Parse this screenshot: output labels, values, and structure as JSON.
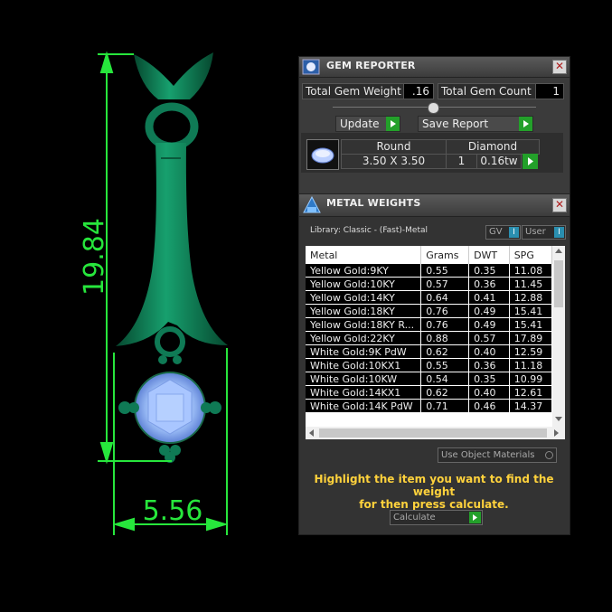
{
  "viewport": {
    "dim_height": "19.84",
    "dim_width": "5.56"
  },
  "gem_reporter": {
    "title": "GEM REPORTER",
    "close_symbol": "✕",
    "total_weight_label": "Total Gem Weight",
    "total_weight_value": ".16",
    "total_count_label": "Total Gem Count",
    "total_count_value": "1",
    "update_label": "Update",
    "save_report_label": "Save Report",
    "gem": {
      "shape": "Round",
      "type": "Diamond",
      "size": "3.50 X 3.50",
      "count": "1",
      "weight": "0.16tw"
    }
  },
  "metal_weights": {
    "title": "METAL WEIGHTS",
    "close_symbol": "✕",
    "library": "Library: Classic - (Fast)-Metal",
    "gv_label": "GV",
    "user_label": "User",
    "toggle_mark": "I",
    "columns": [
      "Metal",
      "Grams",
      "DWT",
      "SPG"
    ],
    "rows": [
      [
        "Yellow Gold:9KY",
        "0.55",
        "0.35",
        "11.08"
      ],
      [
        "Yellow Gold:10KY",
        "0.57",
        "0.36",
        "11.45"
      ],
      [
        "Yellow Gold:14KY",
        "0.64",
        "0.41",
        "12.88"
      ],
      [
        "Yellow Gold:18KY",
        "0.76",
        "0.49",
        "15.41"
      ],
      [
        "Yellow Gold:18KY R...",
        "0.76",
        "0.49",
        "15.41"
      ],
      [
        "Yellow Gold:22KY",
        "0.88",
        "0.57",
        "17.89"
      ],
      [
        "White Gold:9K PdW",
        "0.62",
        "0.40",
        "12.59"
      ],
      [
        "White Gold:10KX1",
        "0.55",
        "0.36",
        "11.18"
      ],
      [
        "White Gold:10KW",
        "0.54",
        "0.35",
        "10.99"
      ],
      [
        "White Gold:14KX1",
        "0.62",
        "0.40",
        "12.61"
      ],
      [
        "White Gold:14K PdW",
        "0.71",
        "0.46",
        "14.37"
      ]
    ],
    "use_object_materials": "Use Object Materials",
    "highlight_line1": "Highlight the item you want to find the weight",
    "highlight_line2": "for then press calculate.",
    "calculate_label": "Calculate"
  },
  "colors": {
    "dimension": "#27e63c",
    "metal": "#0f7a55",
    "gem": "#8fb8f5",
    "accent_green": "#23a02a",
    "highlight": "#ffd23c"
  }
}
